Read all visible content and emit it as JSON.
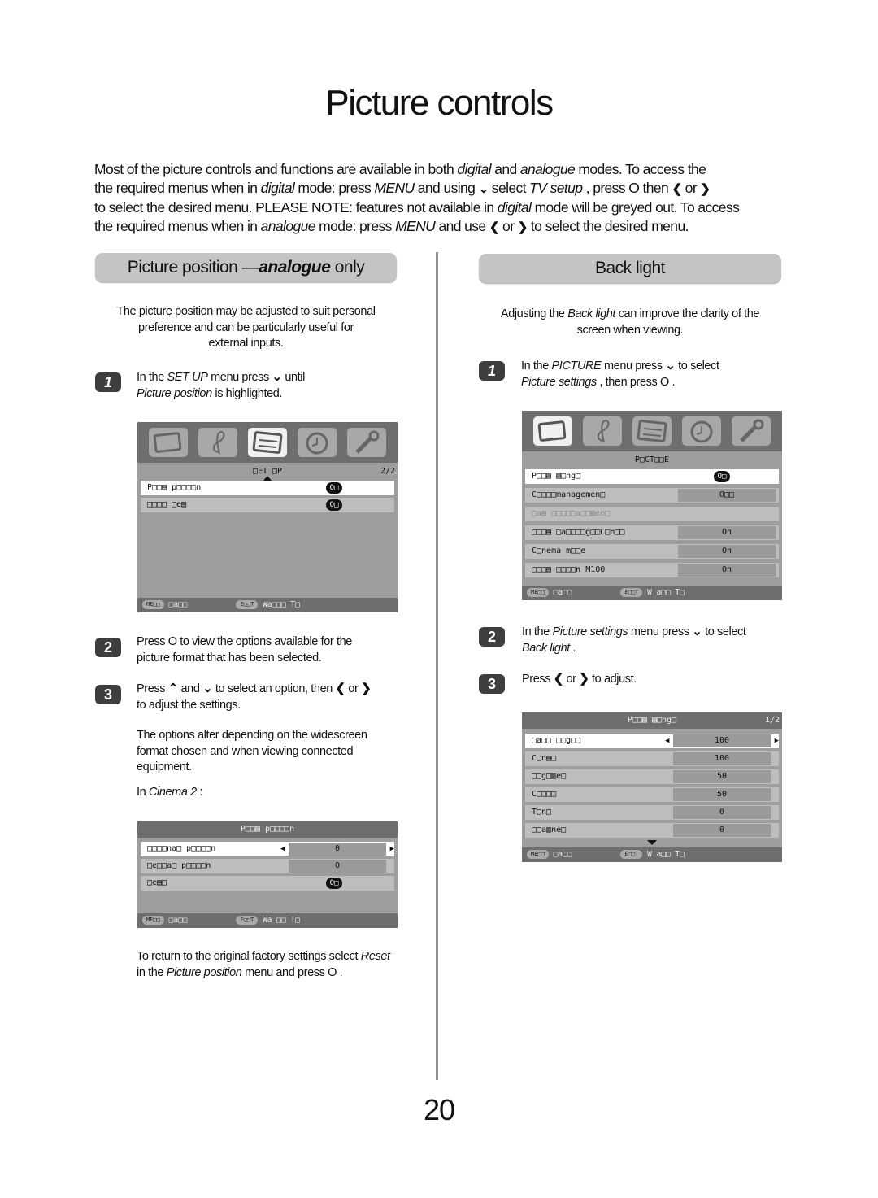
{
  "page": {
    "title": "Picture controls",
    "page_number": "20",
    "intro": {
      "l1a": "Most of the picture controls and functions are available in both ",
      "l1b": "digital",
      "l1c": " and ",
      "l1d": "analogue",
      "l1e": " modes. To access the",
      "l2a": "the required menus when in ",
      "l2b": "digital",
      "l2c": " mode: press ",
      "l2d": "MENU",
      "l2e": " and using ",
      "l2f": " select ",
      "l2g": "TV setup",
      "l2h": " , press O  then ",
      "l2i": " or ",
      "l3a": "to select the desired menu.  PLEASE NOTE: features not available in ",
      "l3b": "digital",
      "l3c": " mode will be greyed out.  To access",
      "l4a": "the required menus when in ",
      "l4b": "analogue",
      "l4c": " mode: press ",
      "l4d": "MENU",
      "l4e": " and use ",
      "l4f": " or ",
      "l4g": " to select the desired menu."
    },
    "icons": {
      "down": "⌄",
      "up": "⌃",
      "left": "❮",
      "right": "❯"
    }
  },
  "left": {
    "heading_a": "Picture position —",
    "heading_b": "analogue",
    "heading_c": " only",
    "desc": [
      "The picture position may be adjusted to suit personal",
      "preference and can be particularly useful for",
      "external inputs."
    ],
    "step1": {
      "num": "1",
      "a": "In the ",
      "b": "SET UP",
      "c": " menu press ",
      "d": " until",
      "e": "Picture position",
      "f": " is highlighted."
    },
    "setup_menu": {
      "title": "□ET □P",
      "page": "2/2",
      "rows": [
        {
          "label": "P□□▤ p□□□□n",
          "value": "O□"
        },
        {
          "label": "□□□□ □e▤",
          "value": "O□"
        }
      ],
      "footer_btn1": "ME□□",
      "footer_txt1": "□a□□",
      "footer_btn2": "E□□T",
      "footer_txt2": "Wa□□□ T□"
    },
    "step2": {
      "num": "2",
      "a": "Press O  to view the options available for the",
      "b": "picture format that has been selected."
    },
    "step3": {
      "num": "3",
      "a": "Press ",
      "b": " and ",
      "c": " to select an option, then ",
      "d": " or ",
      "e": "to adjust the settings."
    },
    "note": [
      "The options alter depending on the widescreen",
      "format chosen and when viewing connected",
      "equipment."
    ],
    "cinema_a": "In ",
    "cinema_b": "Cinema 2",
    "cinema_c": " :",
    "position_menu": {
      "title": "P□□▤ p□□□□n",
      "rows": [
        {
          "label": "□□□□na□ p□□□□n",
          "value": "0"
        },
        {
          "label": "□e□□a□ p□□□□n",
          "value": "0"
        },
        {
          "label": "□e▤□",
          "value": "O□"
        }
      ],
      "footer_btn1": "ME□□",
      "footer_txt1": "□a□□",
      "footer_btn2": "E□□T",
      "footer_txt2": "Wa □□ T□"
    },
    "reset_a": "To return to the original factory settings select ",
    "reset_b": "Reset",
    "reset_c": "in the ",
    "reset_d": "Picture position",
    "reset_e": " menu and press O ."
  },
  "right": {
    "heading": "Back light",
    "desc_a": "Adjusting the ",
    "desc_b": "Back light",
    "desc_c": " can improve the clarity of the",
    "desc_d": "screen when viewing.",
    "step1": {
      "num": "1",
      "a": "In the ",
      "b": "PICTURE",
      "c": " menu press ",
      "d": " to select",
      "e": "Picture settings",
      "f": " , then press O ."
    },
    "picture_menu": {
      "title": "P□CT□□E",
      "rows": [
        {
          "label": "P□□▤ ▤□ng□",
          "value": "O□",
          "kind": "pill"
        },
        {
          "label": "C□□□□managemen□",
          "value": "O□□",
          "kind": "box"
        },
        {
          "label": "□a▤ □□□□□a□□▥en□",
          "value": "",
          "kind": "grey"
        },
        {
          "label": "□□□▤ □a□□□□g□□C□n□□",
          "value": "On",
          "kind": "box"
        },
        {
          "label": "C□nema m□□e",
          "value": "On",
          "kind": "box"
        },
        {
          "label": "□□□▤ □□□□n M100",
          "value": "On",
          "kind": "box"
        }
      ],
      "footer_btn1": "ME□□",
      "footer_txt1": "□a□□",
      "footer_btn2": "E□□T",
      "footer_txt2": "W a□□ T□"
    },
    "step2": {
      "num": "2",
      "a": "In the ",
      "b": "Picture settings",
      "c": " menu press ",
      "d": " to select",
      "e": "Back light",
      "f": " ."
    },
    "step3": {
      "num": "3",
      "a": "Press ",
      "b": " or ",
      "c": " to adjust."
    },
    "settings_menu": {
      "title": "P□□▤ ▤□ng□",
      "page": "1/2",
      "rows": [
        {
          "label": "□a□□ □□g□□",
          "value": "100"
        },
        {
          "label": "C□n▤□",
          "value": "100"
        },
        {
          "label": "□□g□▥e□",
          "value": "50"
        },
        {
          "label": "C□□□□",
          "value": "50"
        },
        {
          "label": "T□n□",
          "value": "0"
        },
        {
          "label": "□□a▥ne□",
          "value": "0"
        }
      ],
      "footer_btn1": "ME□□",
      "footer_txt1": "□a□□",
      "footer_btn2": "E□□T",
      "footer_txt2": "W a□□ T□"
    }
  }
}
